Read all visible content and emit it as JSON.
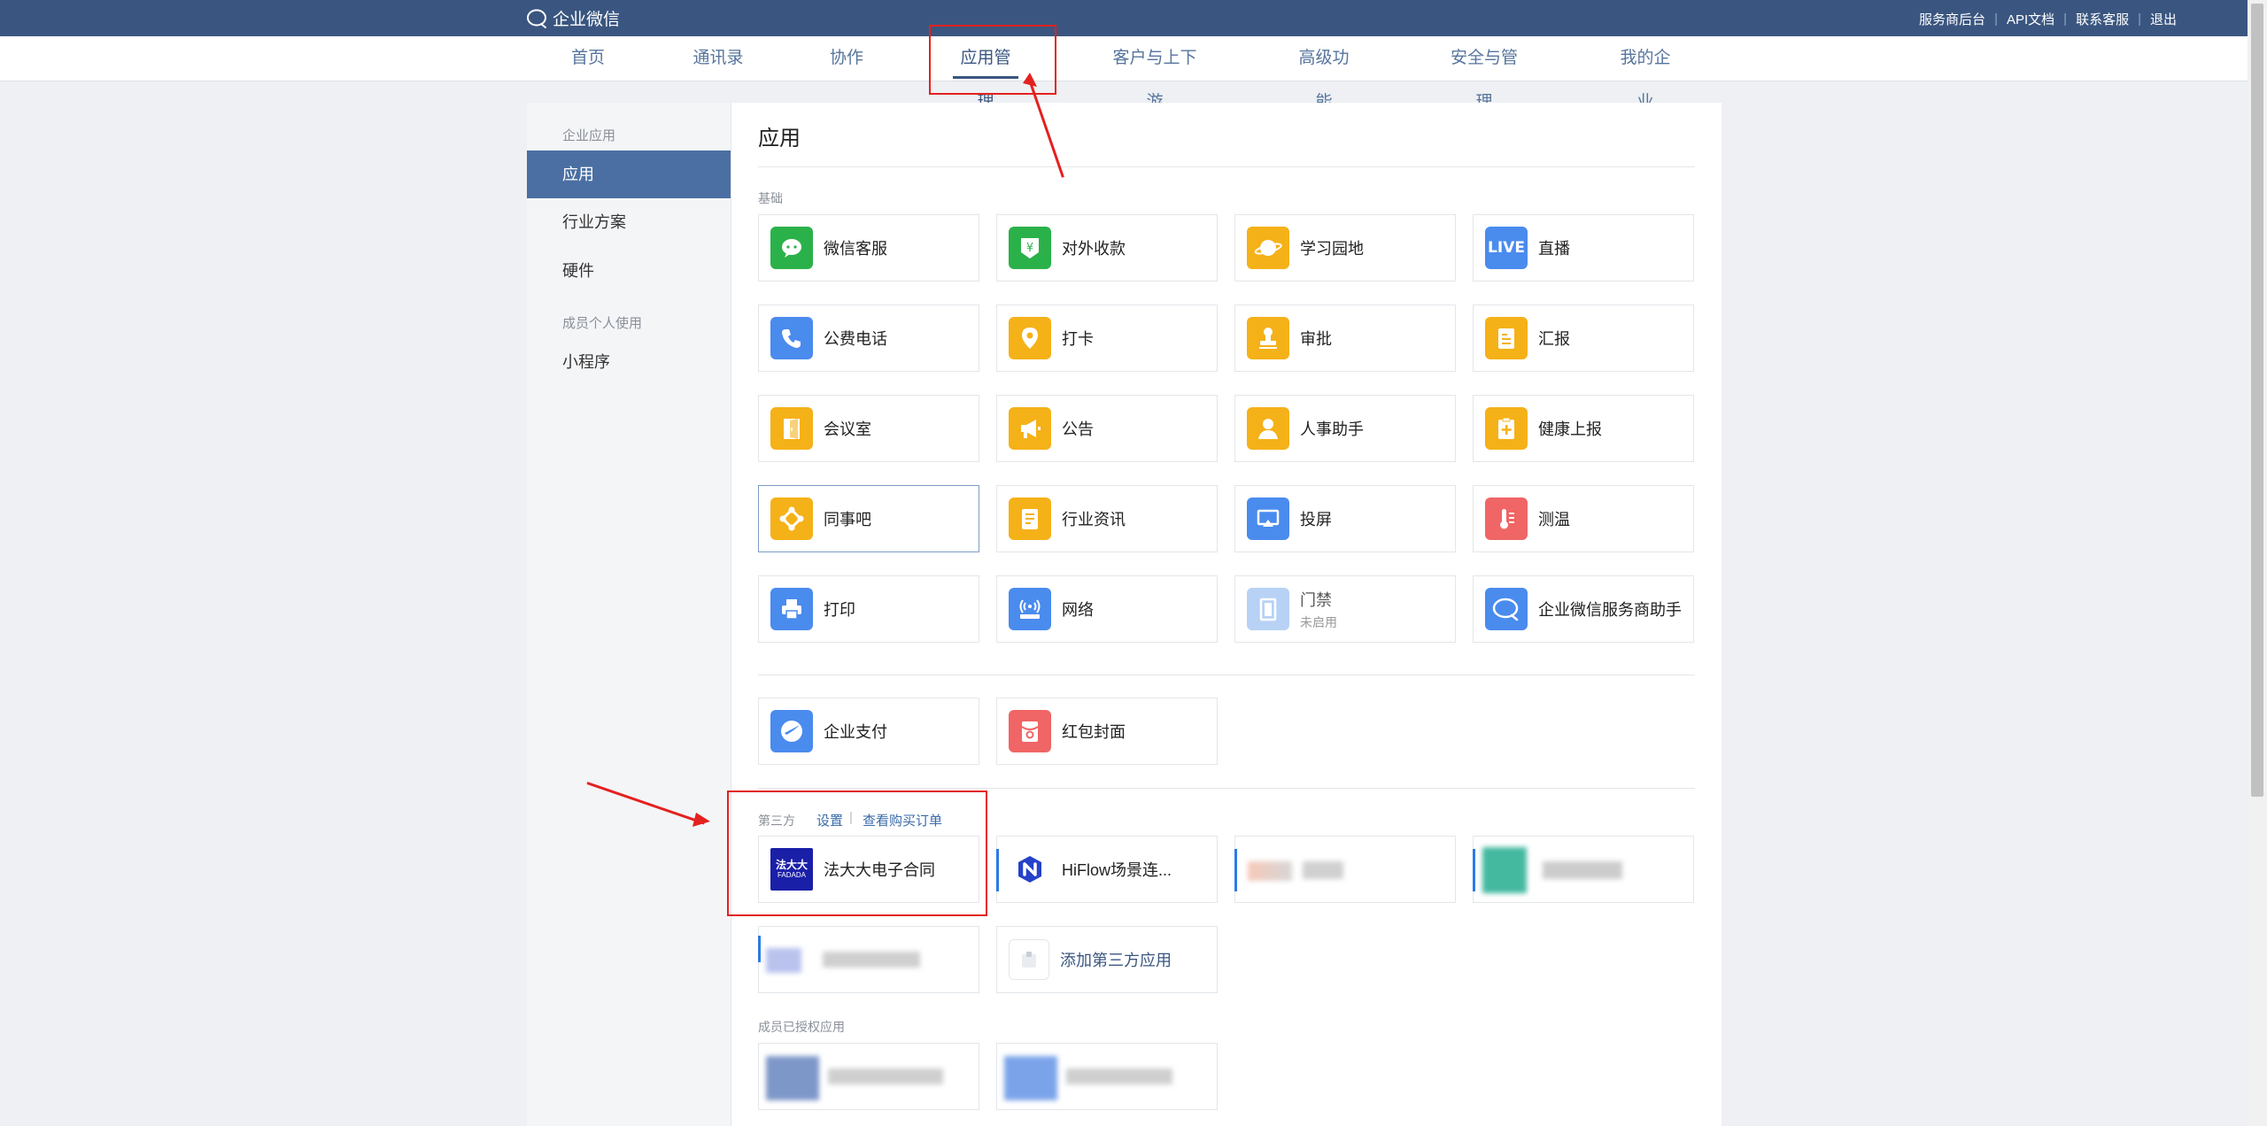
{
  "topbar": {
    "logo_text": "企业微信",
    "links": [
      "服务商后台",
      "API文档",
      "联系客服",
      "退出"
    ]
  },
  "nav": {
    "items": [
      "首页",
      "通讯录",
      "协作",
      "应用管理",
      "客户与上下游",
      "高级功能",
      "安全与管理",
      "我的企业"
    ],
    "active": "应用管理"
  },
  "sidebar": {
    "group1": "企业应用",
    "items1": [
      "应用",
      "行业方案",
      "硬件"
    ],
    "group2": "成员个人使用",
    "items2": [
      "小程序"
    ],
    "active": "应用"
  },
  "content": {
    "title": "应用",
    "basic_label": "基础",
    "basic_apps": [
      {
        "name": "微信客服",
        "icon": "wechat-service-icon",
        "color": "#2bb14a"
      },
      {
        "name": "对外收款",
        "icon": "payment-yen-icon",
        "color": "#2bb14a"
      },
      {
        "name": "学习园地",
        "icon": "planet-icon",
        "color": "#f5b118"
      },
      {
        "name": "直播",
        "icon": "live-icon",
        "color": "#4a8bee"
      },
      {
        "name": "公费电话",
        "icon": "phone-icon",
        "color": "#4a8bee"
      },
      {
        "name": "打卡",
        "icon": "location-pin-icon",
        "color": "#f5b118"
      },
      {
        "name": "审批",
        "icon": "stamp-icon",
        "color": "#f5b118"
      },
      {
        "name": "汇报",
        "icon": "report-doc-icon",
        "color": "#f5b118"
      },
      {
        "name": "会议室",
        "icon": "door-icon",
        "color": "#f5b118"
      },
      {
        "name": "公告",
        "icon": "megaphone-icon",
        "color": "#f5b118"
      },
      {
        "name": "人事助手",
        "icon": "person-icon",
        "color": "#f5b118"
      },
      {
        "name": "健康上报",
        "icon": "health-clipboard-icon",
        "color": "#f5b118"
      },
      {
        "name": "同事吧",
        "icon": "colleague-network-icon",
        "color": "#f5b118"
      },
      {
        "name": "行业资讯",
        "icon": "news-doc-icon",
        "color": "#f5b118"
      },
      {
        "name": "投屏",
        "icon": "screen-cast-icon",
        "color": "#4a8bee"
      },
      {
        "name": "测温",
        "icon": "thermometer-icon",
        "color": "#f06565"
      },
      {
        "name": "打印",
        "icon": "printer-icon",
        "color": "#4a8bee"
      },
      {
        "name": "网络",
        "icon": "wifi-router-icon",
        "color": "#4a8bee"
      },
      {
        "name": "门禁",
        "sub": "未启用",
        "icon": "access-door-icon",
        "color": "#b7d2f5"
      },
      {
        "name": "企业微信服务商助手",
        "icon": "chat-bubble-icon",
        "color": "#4a8bee"
      }
    ],
    "pay_apps": [
      {
        "name": "企业支付",
        "icon": "enterprise-pay-icon",
        "color": "#4a8bee"
      },
      {
        "name": "红包封面",
        "icon": "red-packet-icon",
        "color": "#f06565"
      }
    ],
    "third_label": "第三方",
    "third_settings": "设置",
    "third_orders": "查看购买订单",
    "third_apps": [
      {
        "name": "法大大电子合同",
        "icon": "fadada-logo-icon",
        "logo_text": "法大大",
        "logo_sub": "FADADA"
      },
      {
        "name": "HiFlow场景连...",
        "icon": "hiflow-logo-icon"
      }
    ],
    "add_third": "添加第三方应用",
    "member_label": "成员已授权应用"
  }
}
